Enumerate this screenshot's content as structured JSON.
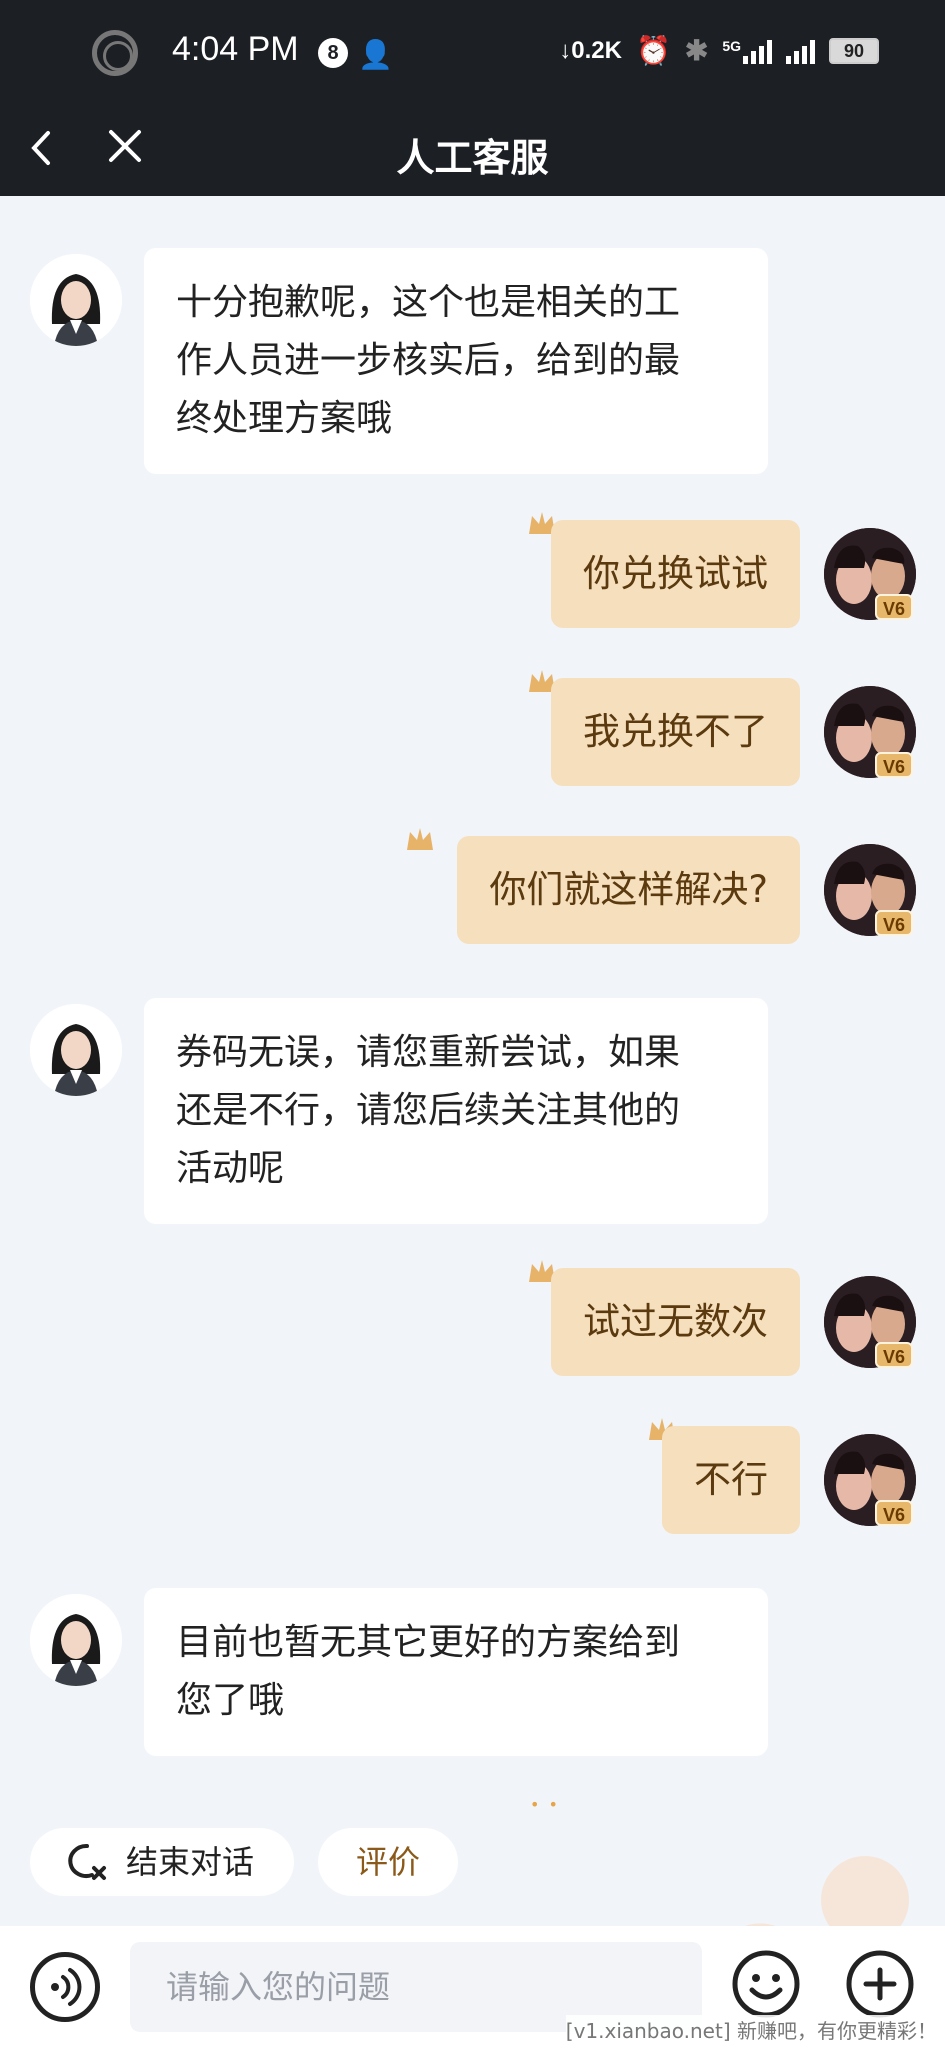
{
  "status_bar": {
    "time": "4:04 PM",
    "notification_count": "8",
    "net_speed": "↓0.2K",
    "network_label": "5G",
    "battery": "90"
  },
  "header": {
    "title": "人工客服"
  },
  "messages": [
    {
      "from": "agent",
      "text_lines": [
        "十分抱歉呢，这个也是相关的工",
        "作人员进一步核实后，给到的最",
        "终处理方案哦"
      ]
    },
    {
      "from": "user",
      "text": "你兑换试试",
      "level": "V6"
    },
    {
      "from": "user",
      "text": "我兑换不了",
      "level": "V6"
    },
    {
      "from": "user",
      "text": "你们就这样解决?",
      "level": "V6"
    },
    {
      "from": "agent",
      "text_lines": [
        "券码无误，请您重新尝试，如果",
        "还是不行，请您后续关注其他的",
        "活动呢"
      ]
    },
    {
      "from": "user",
      "text": "试过无数次",
      "level": "V6"
    },
    {
      "from": "user",
      "text": "不行",
      "level": "V6"
    },
    {
      "from": "agent",
      "text_lines": [
        "目前也暂无其它更好的方案给到",
        "您了哦"
      ]
    }
  ],
  "quick_actions": {
    "end_chat": "结束对话",
    "rate": "评价"
  },
  "input": {
    "placeholder": "请输入您的问题"
  },
  "footer_note": "[v1.xianbao.net] 新赚吧，有你更精彩！",
  "colors": {
    "user_bubble": "#f6dfbd",
    "agent_bubble": "#ffffff",
    "topbar": "#1c1f24",
    "background": "#f1f4f9"
  }
}
